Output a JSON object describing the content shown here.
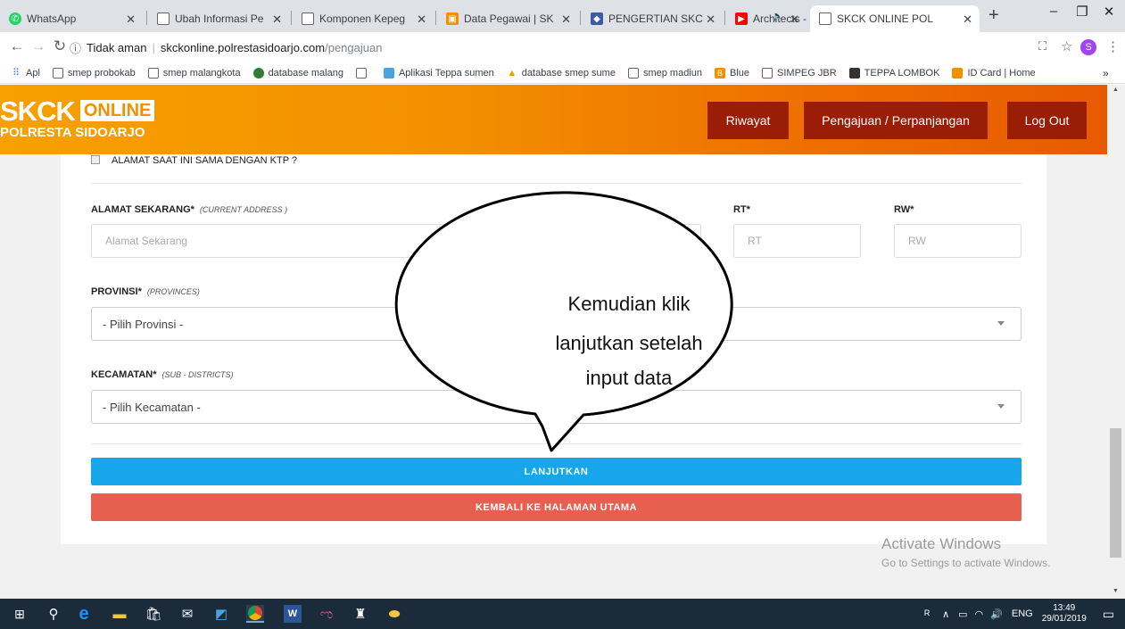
{
  "browser": {
    "tabs": [
      {
        "title": "WhatsApp",
        "icon": "whatsapp-icon",
        "color": "#25d366",
        "glyph": "●"
      },
      {
        "title": "Ubah Informasi Pe",
        "icon": "document-icon",
        "color": "#ffffff",
        "glyph": ""
      },
      {
        "title": "Komponen Kepeg",
        "icon": "document-icon",
        "color": "#ffffff",
        "glyph": ""
      },
      {
        "title": "Data Pegawai | SK",
        "icon": "app-orange-icon",
        "color": "#f39000",
        "glyph": "▣"
      },
      {
        "title": "PENGERTIAN SKC",
        "icon": "site-logo-icon",
        "color": "#3b5ba5",
        "glyph": "◆"
      },
      {
        "title": "Architects - Su",
        "icon": "youtube-icon",
        "color": "#ff0000",
        "glyph": "▶"
      },
      {
        "title": "SKCK ONLINE POL",
        "icon": "document-icon",
        "color": "#ffffff",
        "glyph": ""
      }
    ],
    "new_tab": "+",
    "address": {
      "security": "Tidak aman",
      "host": "skckonline.polrestasidoarjo.com",
      "path": "/pengajuan"
    },
    "profile_initial": "S",
    "bookmarks": [
      {
        "label": "Apl",
        "icon": "apps-grid-icon"
      },
      {
        "label": "smep probokab",
        "icon": "document-icon"
      },
      {
        "label": "smep malangkota",
        "icon": "document-icon"
      },
      {
        "label": "database malang",
        "icon": "green-emblem-icon"
      },
      {
        "label": "",
        "icon": "document-icon"
      },
      {
        "label": "Aplikasi Teppa sumen",
        "icon": "teppa-icon"
      },
      {
        "label": "database smep sume",
        "icon": "kemdikbud-icon"
      },
      {
        "label": "smep madiun",
        "icon": "document-icon"
      },
      {
        "label": "Blue",
        "icon": "blue-icon"
      },
      {
        "label": "SIMPEG JBR",
        "icon": "document-icon"
      },
      {
        "label": "TEPPA LOMBOK",
        "icon": "teppa-dark-icon"
      },
      {
        "label": "ID Card | Home",
        "icon": "app-orange-icon"
      }
    ],
    "more": "»"
  },
  "site": {
    "logo_top": "SKCK",
    "logo_badge": "ONLINE",
    "logo_bottom": "POLRESTA SIDOARJO",
    "nav": [
      "Riwayat",
      "Pengajuan / Perpanjangan",
      "Log Out"
    ]
  },
  "form": {
    "same_as_ktp": "ALAMAT SAAT INI SAMA DENGAN KTP ?",
    "address_label": "ALAMAT SEKARANG*",
    "address_label_en": "(CURRENT ADDRESS )",
    "address_placeholder": "Alamat Sekarang",
    "rt_label": "RT*",
    "rt_placeholder": "RT",
    "rw_label": "RW*",
    "rw_placeholder": "RW",
    "province_label": "PROVINSI*",
    "province_label_en": "(PROVINCES)",
    "province_value": "- Pilih Provinsi -",
    "subdistrict_label": "KECAMATAN*",
    "subdistrict_label_en": "(SUB - DISTRICTS)",
    "subdistrict_value": "- Pilih Kecamatan -",
    "continue_button": "LANJUTKAN",
    "back_button": "KEMBALI KE HALAMAN UTAMA"
  },
  "callout": {
    "line1": "Kemudian klik",
    "line2": "lanjutkan setelah",
    "line3": "input data"
  },
  "watermark": {
    "title": "Activate Windows",
    "subtitle": "Go to Settings to activate Windows."
  },
  "taskbar": {
    "lang": "ENG",
    "time": "13:49",
    "date": "29/01/2019"
  },
  "colors": {
    "continue": "#16a6e9",
    "back": "#e7604f",
    "nav_button": "#9a1d06",
    "banner_start": "#f7a000",
    "banner_end": "#e85a00"
  }
}
